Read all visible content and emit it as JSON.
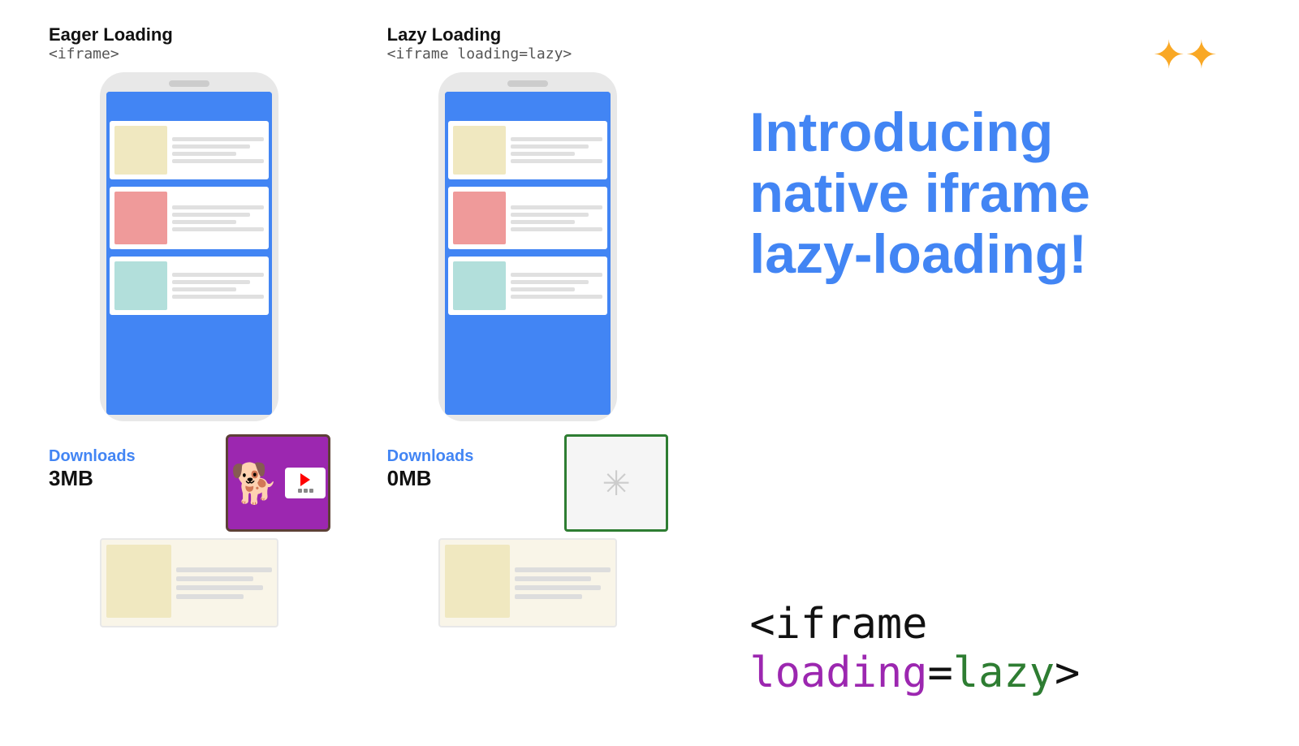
{
  "eager": {
    "title": "Eager Loading",
    "subtitle": "<iframe>",
    "downloads_label": "Downloads",
    "downloads_size": "3MB"
  },
  "lazy": {
    "title": "Lazy Loading",
    "subtitle": "<iframe loading=lazy>",
    "downloads_label": "Downloads",
    "downloads_size": "0MB"
  },
  "right": {
    "main_heading": "Introducing native iframe lazy-loading!",
    "code_line": "<iframe loading=lazy>"
  },
  "sparkle": "✦✦"
}
